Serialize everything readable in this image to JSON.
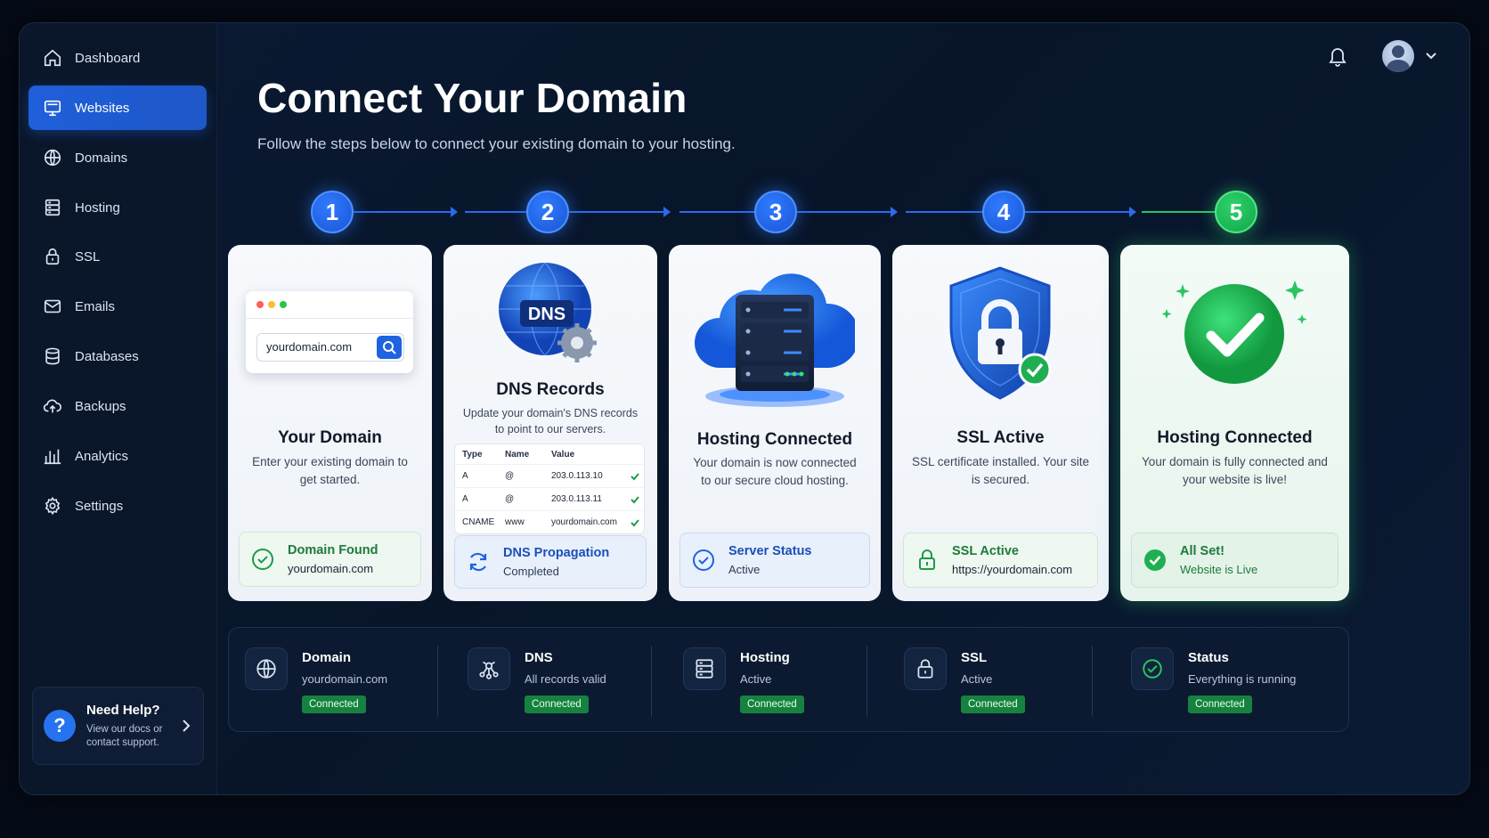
{
  "sidebar": {
    "items": [
      {
        "label": "Dashboard",
        "icon": "home-icon"
      },
      {
        "label": "Websites",
        "icon": "monitor-icon",
        "active": true
      },
      {
        "label": "Domains",
        "icon": "globe-icon"
      },
      {
        "label": "Hosting",
        "icon": "server-icon"
      },
      {
        "label": "SSL",
        "icon": "lock-icon"
      },
      {
        "label": "Emails",
        "icon": "mail-icon"
      },
      {
        "label": "Databases",
        "icon": "database-icon"
      },
      {
        "label": "Backups",
        "icon": "cloud-upload-icon"
      },
      {
        "label": "Analytics",
        "icon": "bar-chart-icon"
      },
      {
        "label": "Settings",
        "icon": "gear-icon"
      }
    ],
    "help": {
      "title": "Need Help?",
      "subtitle": "View our docs or contact support."
    }
  },
  "header": {
    "title": "Connect Your Domain",
    "subtitle": "Follow the steps below to connect your existing domain to your hosting."
  },
  "steps": [
    "1",
    "2",
    "3",
    "4",
    "5"
  ],
  "colors": {
    "accent_blue": "#1f5fd9",
    "success_green": "#16a34a",
    "background": "#081529"
  },
  "cards": {
    "domain": {
      "input_value": "yourdomain.com",
      "title": "Your Domain",
      "desc": "Enter your existing domain to get started.",
      "status_title": "Domain Found",
      "status_sub": "yourdomain.com"
    },
    "dns": {
      "badge": "DNS",
      "title": "DNS Records",
      "desc": "Update your domain's DNS records to point to our servers.",
      "table": {
        "headers": [
          "Type",
          "Name",
          "Value"
        ],
        "rows": [
          [
            "A",
            "@",
            "203.0.113.10"
          ],
          [
            "A",
            "@",
            "203.0.113.11"
          ],
          [
            "CNAME",
            "www",
            "yourdomain.com"
          ]
        ]
      },
      "status_title": "DNS Propagation",
      "status_sub": "Completed"
    },
    "hosting": {
      "title": "Hosting Connected",
      "desc": "Your domain is now connected to our secure cloud hosting.",
      "status_title": "Server Status",
      "status_sub": "Active"
    },
    "ssl": {
      "title": "SSL Active",
      "desc": "SSL certificate installed. Your site is secured.",
      "status_title": "SSL Active",
      "status_sub": "https://yourdomain.com"
    },
    "done": {
      "title": "Hosting Connected",
      "desc": "Your domain is fully connected and your website is live!",
      "status_title": "All Set!",
      "status_sub": "Website is Live"
    }
  },
  "summary": [
    {
      "title": "Domain",
      "sub": "yourdomain.com",
      "badge": "Connected"
    },
    {
      "title": "DNS",
      "sub": "All records valid",
      "badge": "Connected"
    },
    {
      "title": "Hosting",
      "sub": "Active",
      "badge": "Connected"
    },
    {
      "title": "SSL",
      "sub": "Active",
      "badge": "Connected"
    },
    {
      "title": "Status",
      "sub": "Everything is running",
      "badge": "Connected"
    }
  ]
}
